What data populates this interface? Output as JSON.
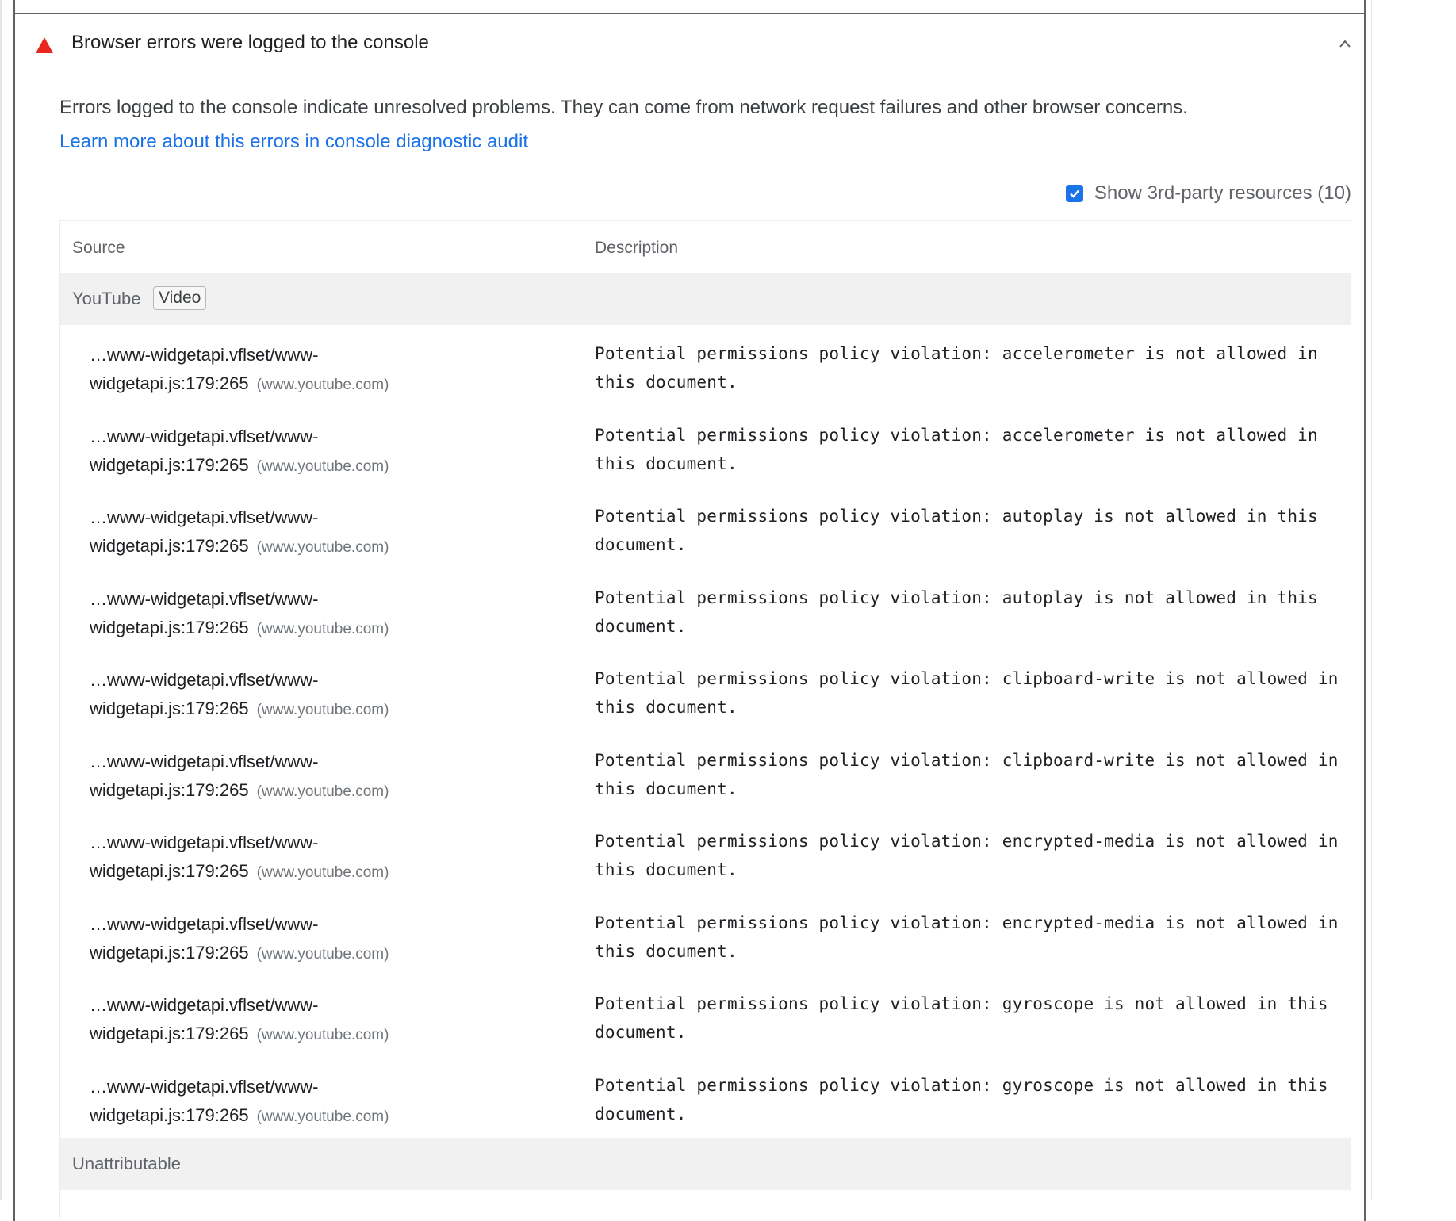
{
  "audit": {
    "title": "Browser errors were logged to the console",
    "icon": "warning-triangle-icon",
    "status_color": "#e8271f",
    "description": "Errors logged to the console indicate unresolved problems. They can come from network request failures and other browser concerns.",
    "learn_more": "Learn more about this errors in console diagnostic audit",
    "link_color": "#1a73e8"
  },
  "third_party": {
    "label": "Show 3rd-party resources (10)",
    "checked": true
  },
  "table": {
    "headers": [
      "Source",
      "Description"
    ],
    "groups": [
      {
        "name": "YouTube",
        "badge": "Video",
        "rows": [
          {
            "source_line1": "…www-widgetapi.vflset/www-",
            "source_line2": "widgetapi.js:179:265",
            "domain": "(www.youtube.com)",
            "description": "Potential permissions policy violation: accelerometer is not allowed in this document."
          },
          {
            "source_line1": "…www-widgetapi.vflset/www-",
            "source_line2": "widgetapi.js:179:265",
            "domain": "(www.youtube.com)",
            "description": "Potential permissions policy violation: accelerometer is not allowed in this document."
          },
          {
            "source_line1": "…www-widgetapi.vflset/www-",
            "source_line2": "widgetapi.js:179:265",
            "domain": "(www.youtube.com)",
            "description": "Potential permissions policy violation: autoplay is not allowed in this document."
          },
          {
            "source_line1": "…www-widgetapi.vflset/www-",
            "source_line2": "widgetapi.js:179:265",
            "domain": "(www.youtube.com)",
            "description": "Potential permissions policy violation: autoplay is not allowed in this document."
          },
          {
            "source_line1": "…www-widgetapi.vflset/www-",
            "source_line2": "widgetapi.js:179:265",
            "domain": "(www.youtube.com)",
            "description": "Potential permissions policy violation: clipboard-write is not allowed in this document."
          },
          {
            "source_line1": "…www-widgetapi.vflset/www-",
            "source_line2": "widgetapi.js:179:265",
            "domain": "(www.youtube.com)",
            "description": "Potential permissions policy violation: clipboard-write is not allowed in this document."
          },
          {
            "source_line1": "…www-widgetapi.vflset/www-",
            "source_line2": "widgetapi.js:179:265",
            "domain": "(www.youtube.com)",
            "description": "Potential permissions policy violation: encrypted-media is not allowed in this document."
          },
          {
            "source_line1": "…www-widgetapi.vflset/www-",
            "source_line2": "widgetapi.js:179:265",
            "domain": "(www.youtube.com)",
            "description": "Potential permissions policy violation: encrypted-media is not allowed in this document."
          },
          {
            "source_line1": "…www-widgetapi.vflset/www-",
            "source_line2": "widgetapi.js:179:265",
            "domain": "(www.youtube.com)",
            "description": "Potential permissions policy violation: gyroscope is not allowed in this document."
          },
          {
            "source_line1": "…www-widgetapi.vflset/www-",
            "source_line2": "widgetapi.js:179:265",
            "domain": "(www.youtube.com)",
            "description": "Potential permissions policy violation: gyroscope is not allowed in this document."
          }
        ]
      },
      {
        "name": "Unattributable",
        "badge": "",
        "rows": []
      }
    ]
  }
}
